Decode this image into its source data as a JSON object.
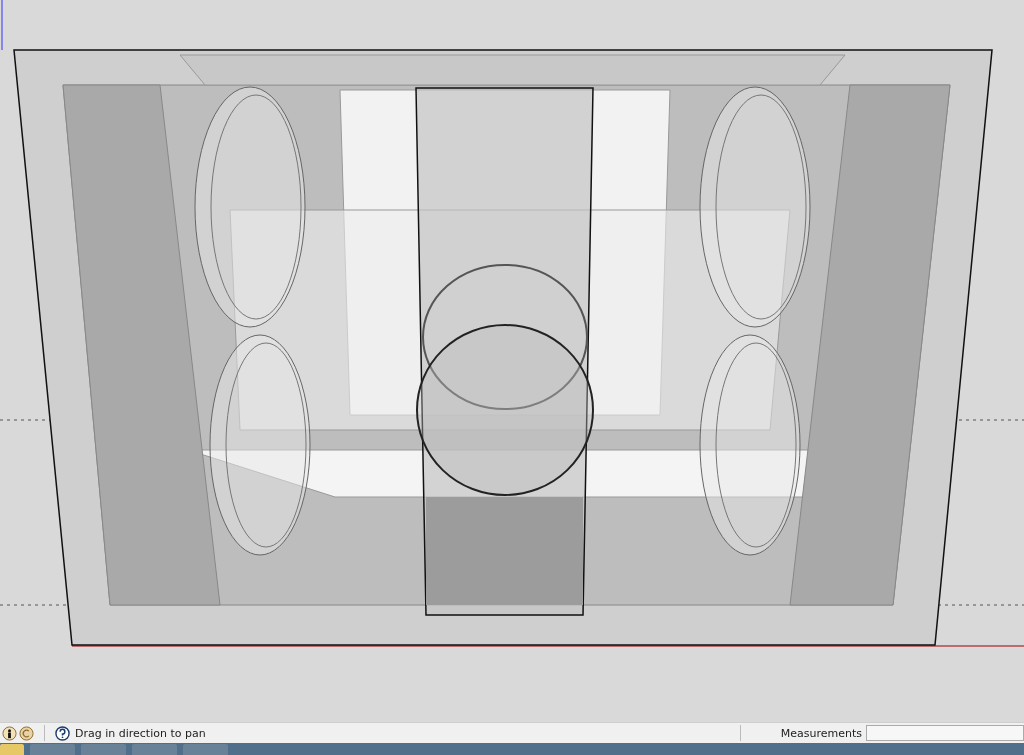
{
  "status_bar": {
    "hint": "Drag in direction to pan",
    "measurements_label": "Measurements"
  }
}
